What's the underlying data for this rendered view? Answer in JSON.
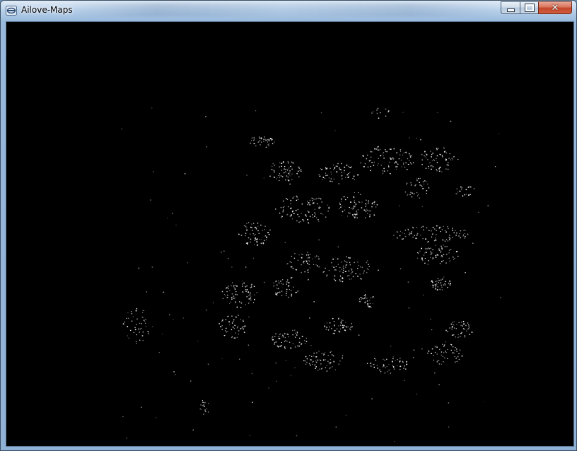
{
  "window": {
    "title": "Ailove-Maps",
    "icon": "app-window-icon"
  },
  "caption_buttons": {
    "minimize_icon": "minimize-icon",
    "maximize_icon": "maximize-icon",
    "close_label": "✕"
  },
  "map": {
    "background_color": "#000000",
    "point_color": "#ffffff"
  }
}
